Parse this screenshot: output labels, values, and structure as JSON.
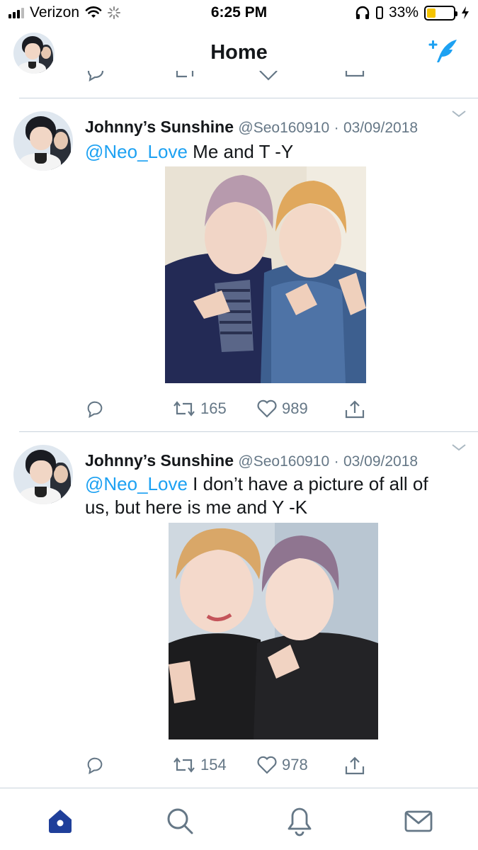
{
  "status_bar": {
    "carrier": "Verizon",
    "time": "6:25 PM",
    "battery_percent": "33%",
    "battery_level": 0.33,
    "icons": [
      "signal-icon",
      "wifi-icon",
      "activity-spinner-icon",
      "headphones-icon",
      "battery-icon",
      "charging-bolt-icon"
    ]
  },
  "header": {
    "title": "Home",
    "compose_icon": "compose-tweet-icon",
    "accent_color": "#1da1f2"
  },
  "tweets": [
    {
      "name": "Johnny’s Sunshine",
      "handle": "@Seo160910",
      "separator": "·",
      "date": "03/09/2018",
      "mention": "@Neo_Love",
      "text": " Me and T -Y",
      "retweets": "165",
      "likes": "989"
    },
    {
      "name": "Johnny’s Sunshine",
      "handle": "@Seo160910",
      "separator": "·",
      "date": "03/09/2018",
      "mention": "@Neo_Love",
      "text": " I don’t have a picture of all of us, but here is me and Y -K",
      "retweets": "154",
      "likes": "978"
    }
  ],
  "tab_bar": {
    "items": [
      "home-tab",
      "search-tab",
      "notifications-tab",
      "messages-tab"
    ],
    "active": "home-tab",
    "active_color": "#1f3f9a"
  }
}
